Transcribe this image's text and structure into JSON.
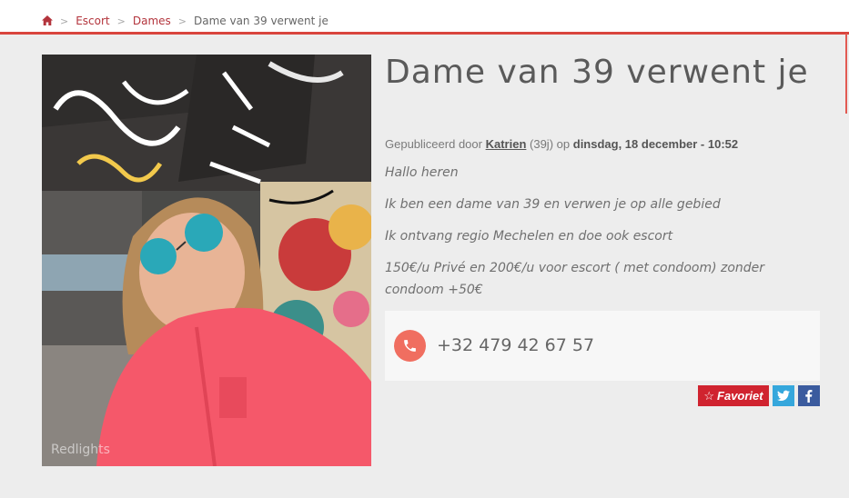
{
  "breadcrumb": {
    "home_icon": "home-icon",
    "items": [
      "Escort",
      "Dames"
    ],
    "current": "Dame van 39 verwent je",
    "separator": ">"
  },
  "listing": {
    "title": "Dame van 39 verwent je",
    "meta": {
      "prefix": "Gepubliceerd door",
      "author": "Katrien",
      "age": "(39j)",
      "on": "op",
      "date": "dinsdag, 18 december - 10:52"
    },
    "description": [
      "Hallo heren",
      "Ik ben een dame van 39 en verwen je op alle gebied",
      "Ik ontvang regio Mechelen en doe ook escort",
      "150€/u Privé en 200€/u voor escort ( met condoom) zonder condoom +50€"
    ],
    "photo_watermark": "Redlights",
    "phone": {
      "icon": "phone-icon",
      "number": "+32 479 42 67 57"
    }
  },
  "actions": {
    "favorite_label": "Favoriet",
    "favorite_icon": "star-outline-icon",
    "twitter_icon": "twitter-icon",
    "facebook_icon": "facebook-icon"
  },
  "colors": {
    "accent_red": "#d9453d",
    "favorite_red": "#d0232f",
    "phone_circle": "#f06e60",
    "twitter_blue": "#35a7dc",
    "facebook_blue": "#3b5b9e",
    "link_color": "#b3343c",
    "background": "#ededed"
  }
}
